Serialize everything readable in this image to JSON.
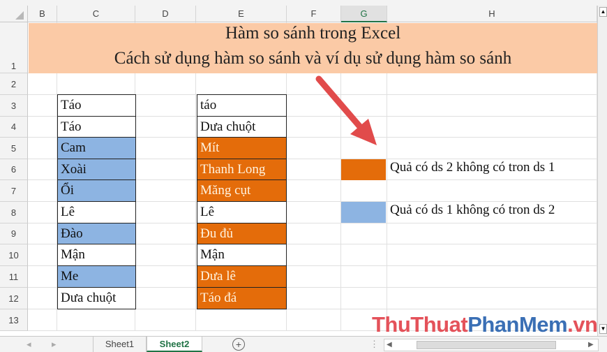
{
  "columns": [
    "B",
    "C",
    "D",
    "E",
    "F",
    "G",
    "H"
  ],
  "selected_column": "G",
  "rows": [
    "1",
    "2",
    "3",
    "4",
    "5",
    "6",
    "7",
    "8",
    "9",
    "10",
    "11",
    "12",
    "13"
  ],
  "title": {
    "line1": "Hàm so sánh trong Excel",
    "line2": "Cách sử dụng hàm so sánh và ví dụ sử dụng hàm so sánh"
  },
  "list1": [
    {
      "text": "Táo",
      "highlight": false
    },
    {
      "text": "Táo",
      "highlight": false
    },
    {
      "text": "Cam",
      "highlight": true
    },
    {
      "text": "Xoài",
      "highlight": true
    },
    {
      "text": "Ổi",
      "highlight": true
    },
    {
      "text": "Lê",
      "highlight": false
    },
    {
      "text": "Đào",
      "highlight": true
    },
    {
      "text": "Mận",
      "highlight": false
    },
    {
      "text": "Me",
      "highlight": true
    },
    {
      "text": "Dưa chuột",
      "highlight": false
    }
  ],
  "list2": [
    {
      "text": "táo",
      "highlight": false
    },
    {
      "text": "Dưa chuột",
      "highlight": false
    },
    {
      "text": "Mít",
      "highlight": true
    },
    {
      "text": "Thanh Long",
      "highlight": true
    },
    {
      "text": "Măng cụt",
      "highlight": true
    },
    {
      "text": "Lê",
      "highlight": false
    },
    {
      "text": "Đu đủ",
      "highlight": true
    },
    {
      "text": "Mận",
      "highlight": false
    },
    {
      "text": "Dưa lê",
      "highlight": true
    },
    {
      "text": "Táo đá",
      "highlight": true
    }
  ],
  "legend": [
    {
      "color": "#e46c0a",
      "text": "Quả có ds 2 không có tron ds 1"
    },
    {
      "color": "#8db4e2",
      "text": "Quả có ds 1 không có tron ds 2"
    }
  ],
  "colors": {
    "blue_fill": "#8db4e2",
    "orange_fill": "#e46c0a",
    "title_fill": "#fbcaa6",
    "arrow": "#e14b4b",
    "excel_green": "#217346"
  },
  "tabs": [
    "Sheet1",
    "Sheet2"
  ],
  "active_tab": "Sheet2",
  "icons": {
    "add_sheet": "plus-circle-icon",
    "prev": "chevron-left-icon",
    "next": "chevron-right-icon"
  },
  "watermark": {
    "part1": "ThuThuat",
    "part2": "PhanMem",
    "part3": ".vn"
  }
}
